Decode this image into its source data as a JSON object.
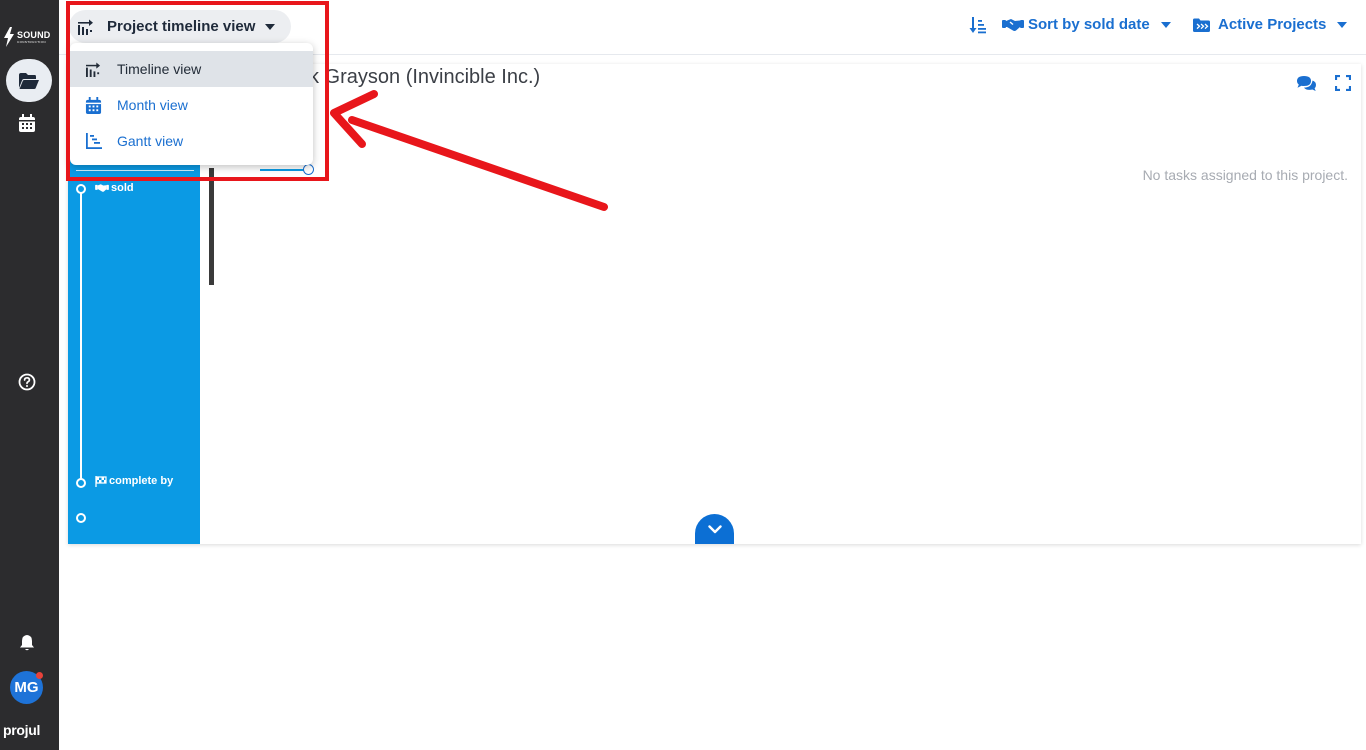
{
  "sidebar": {
    "logo_text": "SOUND",
    "logo_subtext": "CONSTRUCTION",
    "nav": [
      {
        "name": "projects",
        "icon": "folder-open-icon",
        "active": true
      },
      {
        "name": "calendar",
        "icon": "calendar-icon",
        "active": false
      },
      {
        "name": "help",
        "icon": "help-circle-icon",
        "active": false
      },
      {
        "name": "notifications",
        "icon": "bell-icon",
        "active": false
      }
    ],
    "avatar_initials": "MG",
    "brand": "projul"
  },
  "header": {
    "view_select_label": "Project timeline view",
    "sort_label": "Sort by sold date",
    "filter_label": "Active Projects"
  },
  "dropdown": {
    "items": [
      {
        "label": "Timeline view",
        "icon": "timeline-icon",
        "selected": true
      },
      {
        "label": "Month view",
        "icon": "calendar-icon",
        "selected": false
      },
      {
        "label": "Gantt view",
        "icon": "gantt-icon",
        "selected": false
      }
    ]
  },
  "panel": {
    "project_title": "Mark Grayson (Invincible Inc.)",
    "project_title_visible": "k Grayson (Invincible Inc.)",
    "empty_message": "No tasks assigned to this project.",
    "timeline_labels": {
      "sold": "sold",
      "complete_by": "complete by"
    }
  },
  "colors": {
    "sidebar": "#2c2c2e",
    "accent_blue": "#1a6fd0",
    "timeline_blue": "#0b9ae4",
    "annotation_red": "#e8161b"
  }
}
